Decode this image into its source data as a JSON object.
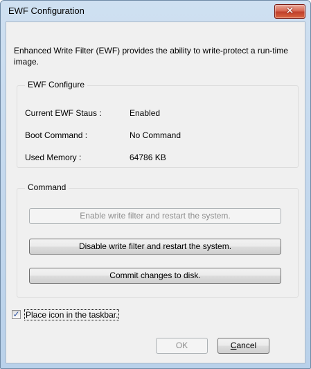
{
  "window": {
    "title": "EWF Configuration",
    "close_glyph": "✕"
  },
  "description": "Enhanced Write Filter (EWF) provides the ability to write-protect a run-time image.",
  "ewf_configure": {
    "label": "EWF Configure",
    "rows": [
      {
        "key": "Current EWF Staus :",
        "value": "Enabled"
      },
      {
        "key": "Boot Command :",
        "value": "No Command"
      },
      {
        "key": "Used Memory :",
        "value": "64786 KB"
      }
    ]
  },
  "command": {
    "label": "Command",
    "enable_label": "Enable write filter and restart the system.",
    "disable_label": "Disable write filter and restart the system.",
    "commit_label": "Commit changes to disk."
  },
  "taskbar_checkbox": {
    "label": "Place icon in the taskbar.",
    "checked": true,
    "check_glyph": "✓"
  },
  "buttons": {
    "ok_label": "OK",
    "cancel_first_letter": "C",
    "cancel_rest": "ancel"
  }
}
